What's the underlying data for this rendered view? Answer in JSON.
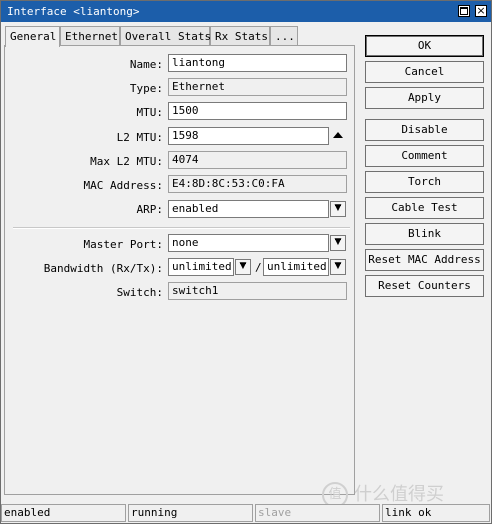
{
  "window": {
    "title": "Interface <liantong>"
  },
  "tabs": [
    {
      "label": "General"
    },
    {
      "label": "Ethernet"
    },
    {
      "label": "Overall Stats"
    },
    {
      "label": "Rx Stats"
    },
    {
      "label": "..."
    }
  ],
  "form": {
    "name": {
      "label": "Name:",
      "value": "liantong"
    },
    "type": {
      "label": "Type:",
      "value": "Ethernet"
    },
    "mtu": {
      "label": "MTU:",
      "value": "1500"
    },
    "l2mtu": {
      "label": "L2 MTU:",
      "value": "1598"
    },
    "max_l2mtu": {
      "label": "Max L2 MTU:",
      "value": "4074"
    },
    "mac": {
      "label": "MAC Address:",
      "value": "E4:8D:8C:53:C0:FA"
    },
    "arp": {
      "label": "ARP:",
      "value": "enabled"
    },
    "master_port": {
      "label": "Master Port:",
      "value": "none"
    },
    "bandwidth": {
      "label": "Bandwidth (Rx/Tx):",
      "rx": "unlimited",
      "tx": "unlimited",
      "sep": "/"
    },
    "switch": {
      "label": "Switch:",
      "value": "switch1"
    }
  },
  "buttons": {
    "ok": "OK",
    "cancel": "Cancel",
    "apply": "Apply",
    "disable": "Disable",
    "comment": "Comment",
    "torch": "Torch",
    "cable_test": "Cable Test",
    "blink": "Blink",
    "reset_mac": "Reset MAC Address",
    "reset_counters": "Reset Counters"
  },
  "status": {
    "s1": "enabled",
    "s2": "running",
    "s3": "slave",
    "s4": "link ok"
  },
  "watermark": {
    "icon_text": "值",
    "text": "什么值得买"
  }
}
